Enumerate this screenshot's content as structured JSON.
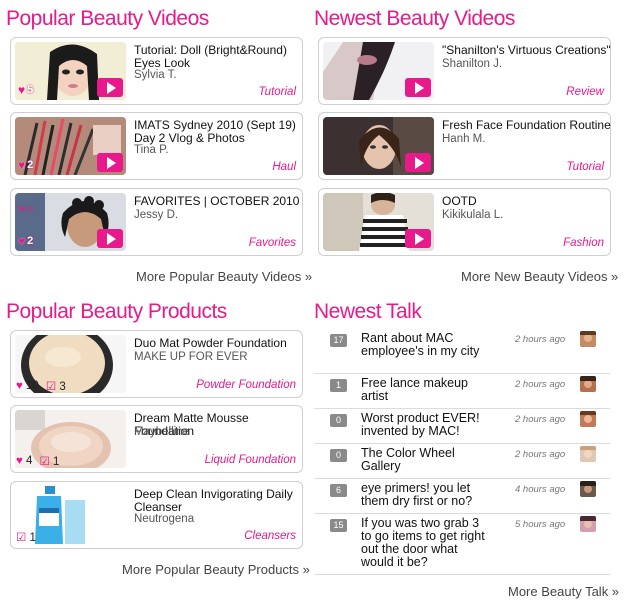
{
  "popular_videos": {
    "title": "Popular Beauty Videos",
    "items": [
      {
        "title": "Tutorial: Doll (Bright&Round) Eyes Look",
        "author": "Sylvia T.",
        "category": "Tutorial",
        "hearts": "5"
      },
      {
        "title": "IMATS Sydney 2010 (Sept 19) Day 2 Vlog & Photos",
        "author": "Tina P.",
        "category": "Haul",
        "hearts": "2"
      },
      {
        "title": "FAVORITES | OCTOBER 2010",
        "author": "Jessy D.",
        "category": "Favorites",
        "hearts": "2"
      }
    ],
    "more": "More Popular Beauty Videos »"
  },
  "newest_videos": {
    "title": "Newest Beauty Videos",
    "items": [
      {
        "title": "\"Shanilton's Virtuous Creations\"",
        "author": "Shanilton J.",
        "category": "Review"
      },
      {
        "title": "Fresh Face Foundation Routine",
        "author": "Hanh M.",
        "category": "Tutorial"
      },
      {
        "title": "OOTD",
        "author": "Kikikulala L.",
        "category": "Fashion"
      }
    ],
    "more": "More New Beauty Videos »"
  },
  "popular_products": {
    "title": "Popular Beauty Products",
    "items": [
      {
        "title": "Duo Mat Powder Foundation",
        "brand": "MAKE UP FOR EVER",
        "category": "Powder Foundation",
        "hearts": "10",
        "checks": "3"
      },
      {
        "title": "Dream Matte Mousse Foundation",
        "brand": "Maybelline",
        "category": "Liquid Foundation",
        "hearts": "4",
        "checks": "1"
      },
      {
        "title": "Deep Clean Invigorating Daily Cleanser",
        "brand": "Neutrogena",
        "category": "Cleansers",
        "checks": "1"
      }
    ],
    "more": "More Popular Beauty Products »"
  },
  "newest_talk": {
    "title": "Newest Talk",
    "items": [
      {
        "count": "17",
        "title": "Rant about MAC employee's in my city",
        "time": "2 hours ago"
      },
      {
        "count": "1",
        "title": "Free lance makeup artist",
        "time": "2 hours ago"
      },
      {
        "count": "0",
        "title": "Worst product EVER! invented by MAC!",
        "time": "2 hours ago"
      },
      {
        "count": "0",
        "title": "The Color Wheel Gallery",
        "time": "2 hours ago"
      },
      {
        "count": "6",
        "title": "eye primers! you let them dry first or no?",
        "time": "4 hours ago"
      },
      {
        "count": "15",
        "title": "If you was two grab 3 to go items to get right out the door what would it be?",
        "time": "5 hours ago"
      }
    ],
    "more": "More Beauty Talk »"
  },
  "icons": {
    "heart": "heart-icon",
    "check": "checkbox-icon",
    "play": "play-icon"
  },
  "colors": {
    "accent": "#e8198b",
    "count_badge": "#8a8a8a"
  }
}
